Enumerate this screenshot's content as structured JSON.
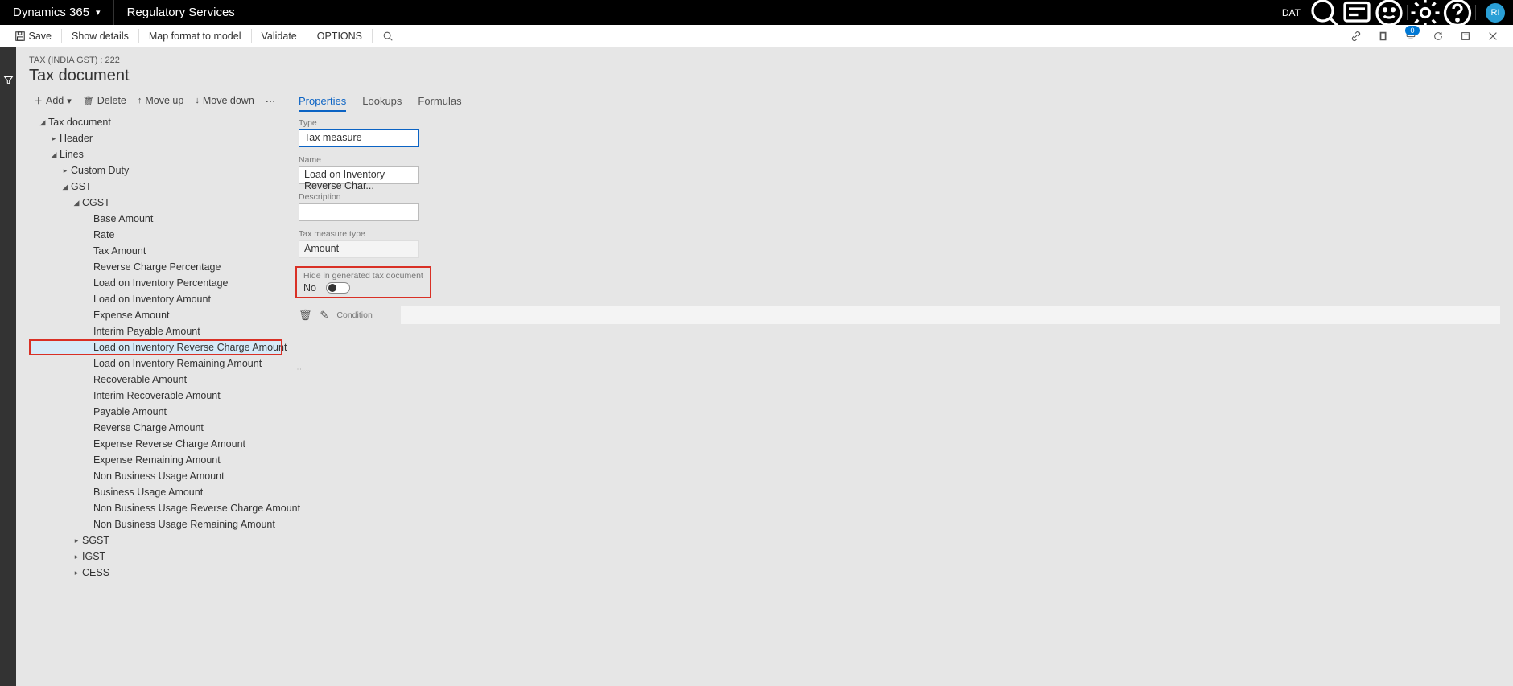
{
  "topbar": {
    "app": "Dynamics 365",
    "module": "Regulatory Services",
    "company": "DAT",
    "avatar": "RI"
  },
  "cmdbar": {
    "save": "Save",
    "show_details": "Show details",
    "map_format": "Map format to model",
    "validate": "Validate",
    "options": "OPTIONS"
  },
  "page": {
    "breadcrumb": "TAX (INDIA GST) : 222",
    "title": "Tax document"
  },
  "left_toolbar": {
    "add": "Add",
    "delete": "Delete",
    "move_up": "Move up",
    "move_down": "Move down"
  },
  "tree": {
    "root": "Tax document",
    "header": "Header",
    "lines": "Lines",
    "custom_duty": "Custom Duty",
    "gst": "GST",
    "cgst": "CGST",
    "cgst_children": [
      "Base Amount",
      "Rate",
      "Tax Amount",
      "Reverse Charge Percentage",
      "Load on Inventory Percentage",
      "Load on Inventory Amount",
      "Expense Amount",
      "Interim Payable Amount",
      "Load on Inventory Reverse Charge Amount",
      "Load on Inventory Remaining Amount",
      "Recoverable Amount",
      "Interim Recoverable Amount",
      "Payable Amount",
      "Reverse Charge Amount",
      "Expense Reverse Charge Amount",
      "Expense Remaining Amount",
      "Non Business Usage Amount",
      "Business Usage Amount",
      "Non Business Usage Reverse Charge Amount",
      "Non Business Usage Remaining Amount"
    ],
    "sgst": "SGST",
    "igst": "IGST",
    "cess": "CESS"
  },
  "tabs": {
    "properties": "Properties",
    "lookups": "Lookups",
    "formulas": "Formulas"
  },
  "form": {
    "type_label": "Type",
    "type_value": "Tax measure",
    "name_label": "Name",
    "name_value": "Load on Inventory Reverse Char...",
    "desc_label": "Description",
    "desc_value": "",
    "measure_type_label": "Tax measure type",
    "measure_type_value": "Amount",
    "hide_label": "Hide in generated tax document",
    "hide_value": "No",
    "condition_label": "Condition"
  }
}
